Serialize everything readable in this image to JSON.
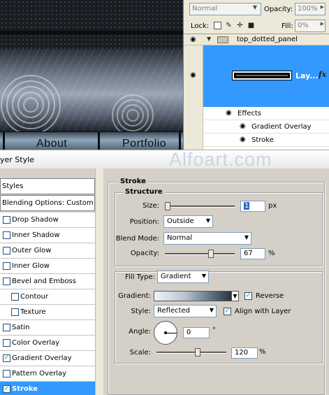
{
  "canvas": {
    "nav_links": [
      "About",
      "Portfolio"
    ]
  },
  "layers_panel": {
    "blend_mode": "Normal",
    "opacity_label": "Opacity:",
    "opacity_value": "100%",
    "lock_label": "Lock:",
    "fill_label": "Fill:",
    "fill_value": "0%",
    "group_name": "top_dotted_panel",
    "selected_layer_name": "Lay...",
    "fx_badge": "fx",
    "effects_label": "Effects",
    "effect_items": [
      "Gradient Overlay",
      "Stroke"
    ]
  },
  "dialog": {
    "title": "yer Style",
    "watermark": "Alfoart.com"
  },
  "styles_list": {
    "header": "Styles",
    "blending_options": "Blending Options: Custom",
    "items": [
      {
        "label": "Drop Shadow",
        "checked": false
      },
      {
        "label": "Inner Shadow",
        "checked": false
      },
      {
        "label": "Outer Glow",
        "checked": false
      },
      {
        "label": "Inner Glow",
        "checked": false
      },
      {
        "label": "Bevel and Emboss",
        "checked": false
      },
      {
        "label": "Contour",
        "checked": false
      },
      {
        "label": "Texture",
        "checked": false
      },
      {
        "label": "Satin",
        "checked": false
      },
      {
        "label": "Color Overlay",
        "checked": false
      },
      {
        "label": "Gradient Overlay",
        "checked": true
      },
      {
        "label": "Pattern Overlay",
        "checked": false
      },
      {
        "label": "Stroke",
        "checked": true
      }
    ]
  },
  "stroke": {
    "title": "Stroke",
    "structure_title": "Structure",
    "size_label": "Size:",
    "size_value": "1",
    "size_unit": "px",
    "size_fraction": 0.0,
    "position_label": "Position:",
    "position_value": "Outside",
    "blend_mode_label": "Blend Mode:",
    "blend_mode_value": "Normal",
    "opacity_label": "Opacity:",
    "opacity_value": "67",
    "opacity_unit": "%",
    "opacity_fraction": 0.67,
    "fill_type_label": "Fill Type:",
    "fill_type_value": "Gradient",
    "gradient_label": "Gradient:",
    "reverse_label": "Reverse",
    "reverse_checked": true,
    "style_label": "Style:",
    "style_value": "Reflected",
    "align_label": "Align with Layer",
    "align_checked": true,
    "angle_label": "Angle:",
    "angle_value": "0",
    "angle_unit": "°",
    "scale_label": "Scale:",
    "scale_value": "120",
    "scale_unit": "%",
    "scale_fraction": 0.6
  },
  "colors": {
    "selection_blue": "#3399ff",
    "dialog_gray": "#d4d0c8",
    "check_green": "#21a121"
  }
}
